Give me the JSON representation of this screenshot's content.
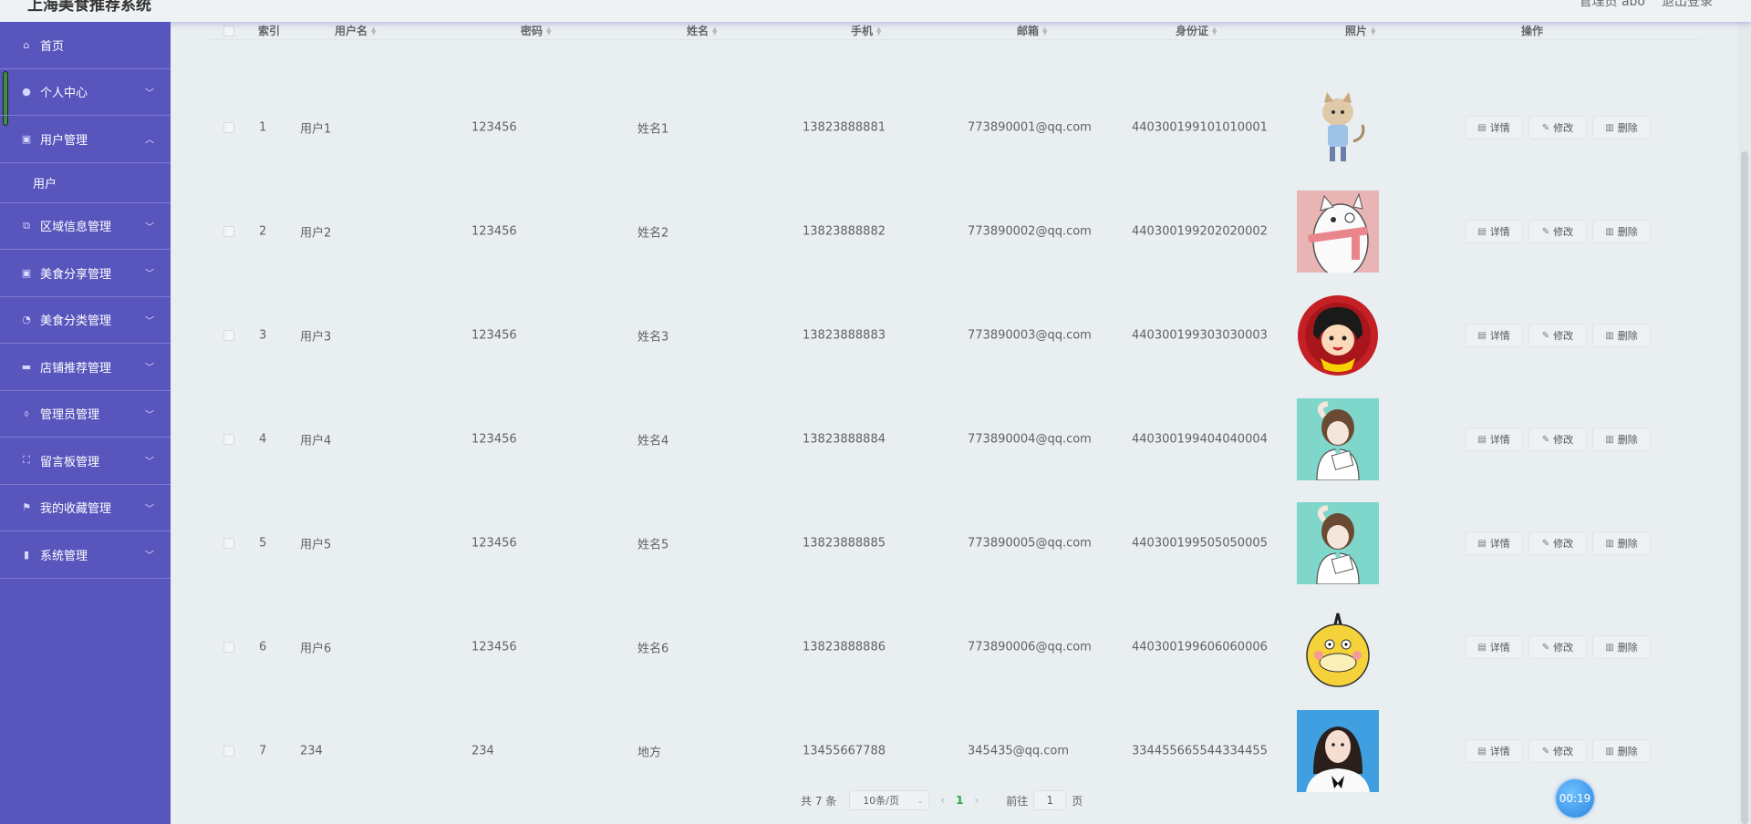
{
  "header": {
    "app_title": "上海美食推荐系统",
    "user_label": "管理员 abo",
    "logout_label": "退出登录"
  },
  "sidebar": {
    "items": [
      {
        "label": "首页",
        "icon": "home-icon",
        "glyph": "⌂",
        "has_chevron": false
      },
      {
        "label": "个人中心",
        "icon": "user-icon",
        "glyph": "●",
        "has_chevron": true
      },
      {
        "label": "用户管理",
        "icon": "clipboard-icon",
        "glyph": "▣",
        "has_chevron": true,
        "expanded": true
      },
      {
        "label": "区域信息管理",
        "icon": "copy-icon",
        "glyph": "⧉",
        "has_chevron": true
      },
      {
        "label": "美食分享管理",
        "icon": "clipboard-icon",
        "glyph": "▣",
        "has_chevron": true
      },
      {
        "label": "美食分类管理",
        "icon": "compass-icon",
        "glyph": "◔",
        "has_chevron": true
      },
      {
        "label": "店铺推荐管理",
        "icon": "chat-icon",
        "glyph": "▬",
        "has_chevron": true
      },
      {
        "label": "管理员管理",
        "icon": "microphone-icon",
        "glyph": "⌽",
        "has_chevron": true
      },
      {
        "label": "留言板管理",
        "icon": "fullscreen-icon",
        "glyph": "⛶",
        "has_chevron": true
      },
      {
        "label": "我的收藏管理",
        "icon": "flag-icon",
        "glyph": "⚑",
        "has_chevron": true
      },
      {
        "label": "系统管理",
        "icon": "bar-chart-icon",
        "glyph": "▮",
        "has_chevron": true
      }
    ],
    "submenu_user": "用户"
  },
  "table": {
    "headers": [
      "索引",
      "用户名",
      "密码",
      "姓名",
      "手机",
      "邮箱",
      "身份证",
      "照片",
      "操作"
    ],
    "rows": [
      {
        "index": "1",
        "username": "用户1",
        "password": "123456",
        "name": "姓名1",
        "phone": "13823888881",
        "email": "773890001@qq.com",
        "idcard": "440300199101010001",
        "photo": "cat-boy-cartoon"
      },
      {
        "index": "2",
        "username": "用户2",
        "password": "123456",
        "name": "姓名2",
        "phone": "13823888882",
        "email": "773890002@qq.com",
        "idcard": "440300199202020002",
        "photo": "white-cat-scarf"
      },
      {
        "index": "3",
        "username": "用户3",
        "password": "123456",
        "name": "姓名3",
        "phone": "13823888883",
        "email": "773890003@qq.com",
        "idcard": "440300199303030003",
        "photo": "maruko-badge"
      },
      {
        "index": "4",
        "username": "用户4",
        "password": "123456",
        "name": "姓名4",
        "phone": "13823888884",
        "email": "773890004@qq.com",
        "idcard": "440300199404040004",
        "photo": "girl-sketch-teal"
      },
      {
        "index": "5",
        "username": "用户5",
        "password": "123456",
        "name": "姓名5",
        "phone": "13823888885",
        "email": "773890005@qq.com",
        "idcard": "440300199505050005",
        "photo": "girl-sketch-teal"
      },
      {
        "index": "6",
        "username": "用户6",
        "password": "123456",
        "name": "姓名6",
        "phone": "13823888886",
        "email": "773890006@qq.com",
        "idcard": "440300199606060006",
        "photo": "yellow-duck"
      },
      {
        "index": "7",
        "username": "234",
        "password": "234",
        "name": "地方",
        "phone": "13455667788",
        "email": "345435@qq.com",
        "idcard": "334455665544334455",
        "photo": "girl-portrait"
      }
    ],
    "actions": {
      "detail": "详情",
      "edit": "修改",
      "delete": "删除"
    }
  },
  "pagination": {
    "total": "共 7 条",
    "page_size": "10条/页",
    "current_page": "1",
    "goto_prefix": "前往",
    "goto_value": "1",
    "goto_suffix": "页"
  },
  "timer": "00:19",
  "colors": {
    "sidebar_bg": "#5856bd",
    "page_bg": "#e9eef0",
    "accent_page": "#2ba84a",
    "timer": "#2a86e0"
  }
}
